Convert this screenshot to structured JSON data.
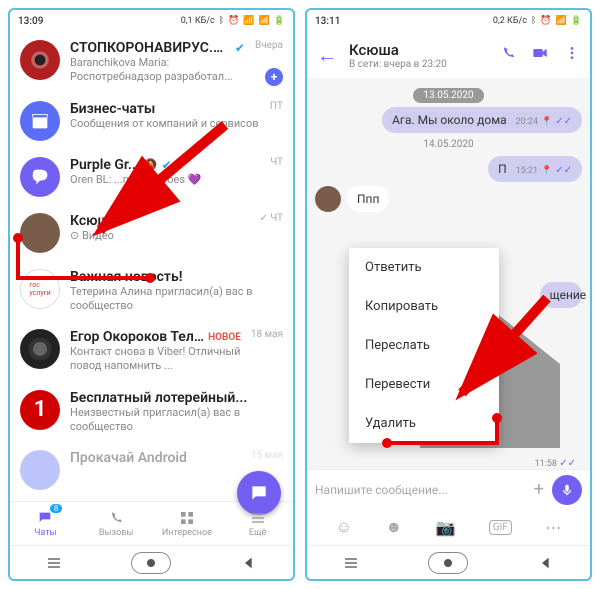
{
  "left": {
    "status": {
      "time": "13:09",
      "net": "0,1 КБ/с"
    },
    "chats": [
      {
        "title": "СТОПКОРОНАВИРУС.РФ",
        "verified": true,
        "sub": "Baranchikova Maria:\nРоспотребнадзор разработал...",
        "meta": "Вчера",
        "avatarBg": "#b02020"
      },
      {
        "title": "Бизнес-чаты",
        "sub": "Сообщения от компаний и сервисов",
        "meta": "ПТ",
        "avatarBg": "#5b6ef5"
      },
      {
        "title": "Purple Gr...",
        "verified": true,
        "sub": "Oren BL: ...ncareHeroes 💜",
        "meta": "ЧТ",
        "avatarBg": "#7360f2"
      },
      {
        "title": "Ксюша",
        "sub": "⊙ Видео",
        "meta": "✓ ЧТ",
        "avatarBg": "#7a5c4a"
      },
      {
        "title": "Важная новость!",
        "sub": "Тетерина Алина пригласил(а) вас в сообщество",
        "meta": "",
        "avatarBg": "#fff"
      },
      {
        "title": "Егор Окороков Тел...",
        "badge": "НОВОЕ",
        "sub": "Контакт снова в Viber! Отличный повод напомнить ...",
        "meta": "18 мая",
        "avatarBg": "#222"
      },
      {
        "title": "Бесплатный лотерейный...",
        "sub": "Неизвестный пригласил(а) вас в сообщество",
        "meta": "",
        "avatarBg": "#d00000"
      },
      {
        "title": "Прокачай Android",
        "sub": "",
        "meta": "15 мая",
        "avatarBg": "#5b6ef5"
      }
    ],
    "tabs": [
      "Чаты",
      "Вызовы",
      "Интересное",
      "Ещё"
    ],
    "tabBadge": "8"
  },
  "right": {
    "status": {
      "time": "13:11",
      "net": "0,2 КБ/с"
    },
    "header": {
      "title": "Ксюша",
      "sub": "В сети: вчера в 23:20"
    },
    "datePill": "13.05.2020",
    "msg1": {
      "text": "Ага. Мы около дома",
      "time": "20:24"
    },
    "dateText": "14.05.2020",
    "msg2": {
      "text": "П",
      "time": "15:21"
    },
    "msg3": {
      "text": "Ппп"
    },
    "msg4": {
      "text": "щение"
    },
    "ctx": [
      "Ответить",
      "Копировать",
      "Переслать",
      "Перевести",
      "Удалить"
    ],
    "imgTime": "11:58",
    "composer": "Напишите сообщение..."
  }
}
